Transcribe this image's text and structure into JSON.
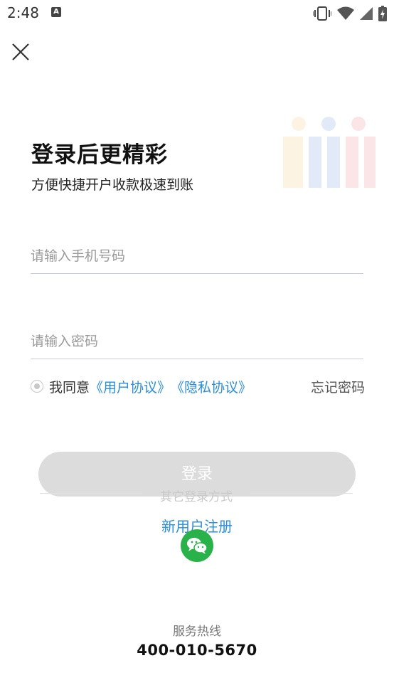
{
  "status_bar": {
    "time": "2:48",
    "notification_icon": "A",
    "icons": [
      "vibrate-icon",
      "wifi-icon",
      "signal-icon",
      "battery-charging-icon"
    ]
  },
  "header": {
    "close_icon": "close-icon"
  },
  "hero": {
    "title": "登录后更精彩",
    "subtitle": "方便快捷开户收款极速到账"
  },
  "form": {
    "phone_placeholder": "请输入手机号码",
    "password_placeholder": "请输入密码",
    "agree_prefix": "我同意",
    "user_agreement": "《用户协议》",
    "privacy_agreement": "《隐私协议》",
    "forgot_password": "忘记密码",
    "login_label": "登录"
  },
  "other_login": {
    "label": "其它登录方式",
    "register": "新用户注册",
    "wechat_icon": "wechat-icon"
  },
  "footer": {
    "hotline_label": "服务热线",
    "hotline_number": "400-010-5670"
  },
  "colors": {
    "accent": "#2b8ed8",
    "wechat": "#29b14a",
    "button_disabled": "#dcdcdc"
  }
}
